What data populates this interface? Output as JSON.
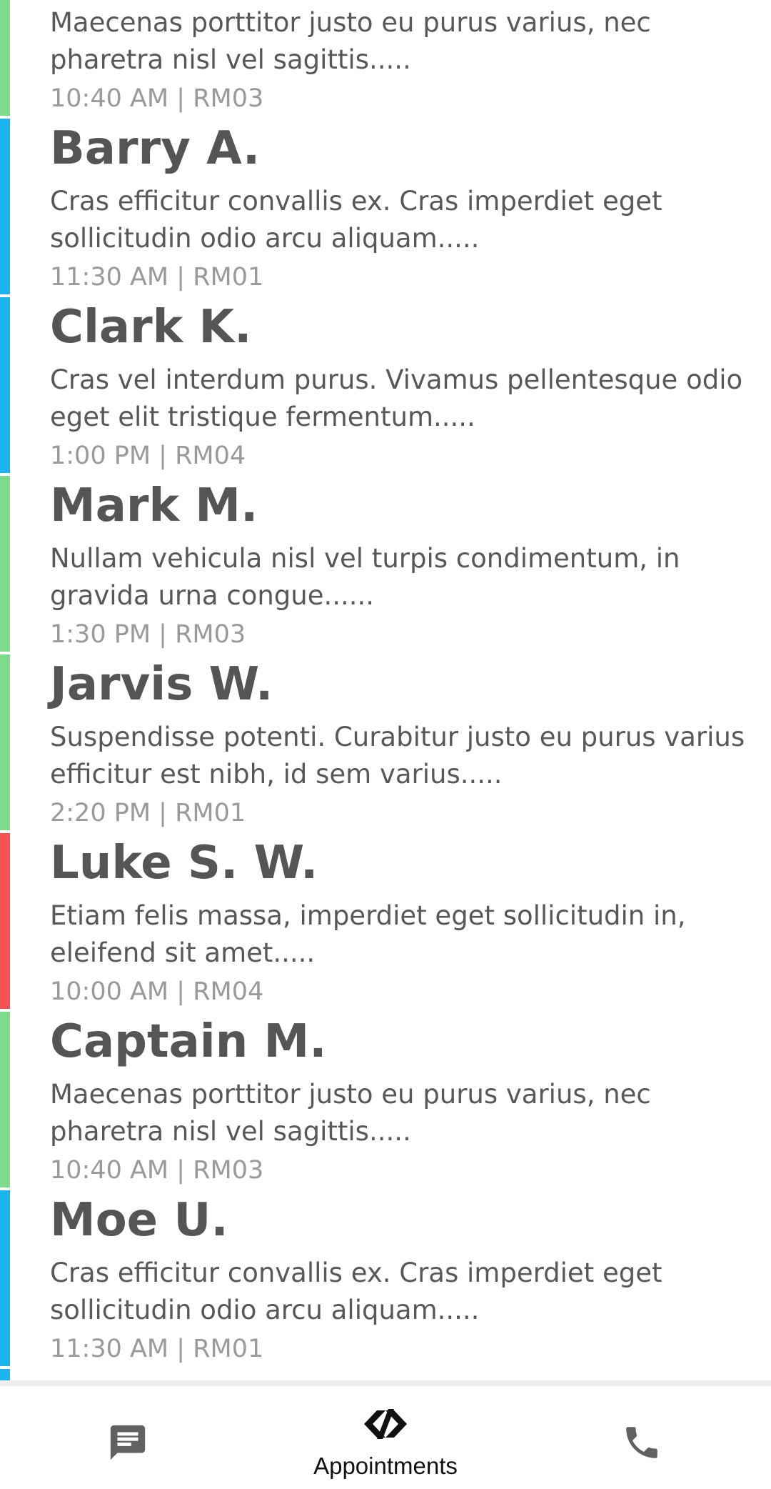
{
  "appointments": [
    {
      "name": "",
      "description": "Maecenas porttitor justo eu purus varius, nec pharetra nisl vel sagittis.....",
      "meta": "10:40 AM | RM03",
      "status_color": "#7edb8a"
    },
    {
      "name": "Barry A.",
      "description": "Cras efficitur convallis ex. Cras imperdiet eget sollicitudin odio arcu aliquam.....",
      "meta": "11:30 AM | RM01",
      "status_color": "#1cb4ec"
    },
    {
      "name": "Clark K.",
      "description": "Cras vel interdum purus. Vivamus pellentesque odio eget elit tristique fermentum.....",
      "meta": "1:00 PM | RM04",
      "status_color": "#1cb4ec"
    },
    {
      "name": "Mark M.",
      "description": "Nullam vehicula nisl vel turpis condimentum, in gravida urna congue......",
      "meta": "1:30 PM | RM03",
      "status_color": "#7edb8a"
    },
    {
      "name": "Jarvis W.",
      "description": "Suspendisse potenti. Curabitur justo eu purus varius efficitur est nibh, id sem varius.....",
      "meta": "2:20 PM | RM01",
      "status_color": "#7edb8a"
    },
    {
      "name": "Luke S. W.",
      "description": "Etiam felis massa, imperdiet eget sollicitudin in, eleifend sit amet.....",
      "meta": "10:00 AM | RM04",
      "status_color": "#f45254"
    },
    {
      "name": "Captain M.",
      "description": "Maecenas porttitor justo eu purus varius, nec pharetra nisl vel sagittis.....",
      "meta": "10:40 AM | RM03",
      "status_color": "#7edb8a"
    },
    {
      "name": "Moe U.",
      "description": "Cras efficitur convallis ex. Cras imperdiet eget sollicitudin odio arcu aliquam.....",
      "meta": "11:30 AM | RM01",
      "status_color": "#1cb4ec"
    }
  ],
  "next_item_status_color": "#1cb4ec",
  "bottom_nav": {
    "messages": {
      "icon": "message-icon",
      "label": ""
    },
    "appointments": {
      "icon": "appointments-logo-icon",
      "label": "Appointments",
      "active": true
    },
    "call": {
      "icon": "phone-icon",
      "label": ""
    }
  },
  "colors": {
    "text_dark": "#555555",
    "text_muted": "#9a9a9a",
    "icon_gray": "#616161",
    "green": "#7edb8a",
    "blue": "#1cb4ec",
    "red": "#f45254"
  }
}
